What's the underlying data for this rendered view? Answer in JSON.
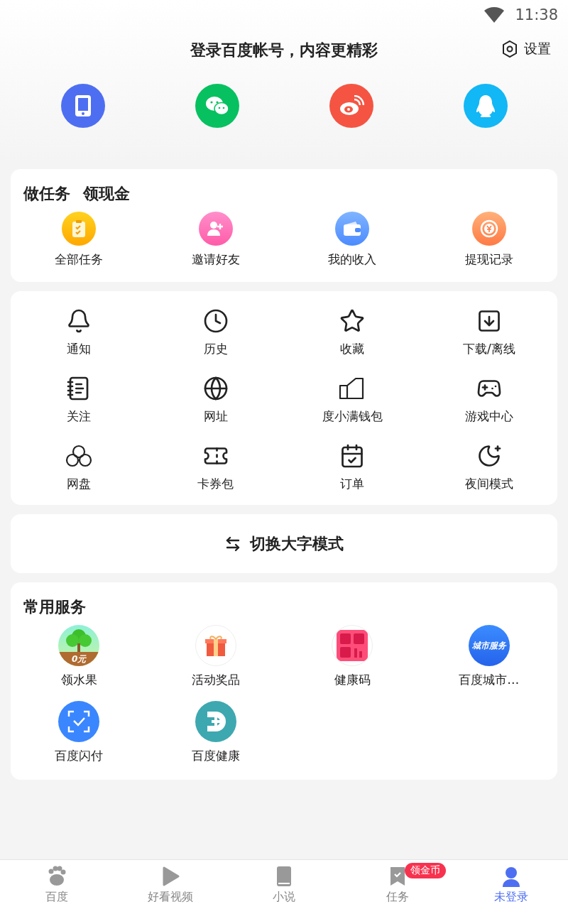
{
  "status_bar": {
    "time": "11:38"
  },
  "header": {
    "title": "登录百度帐号，内容更精彩",
    "settings": "设置"
  },
  "tasks": {
    "title": "做任务",
    "subtitle": "领现金",
    "items": [
      {
        "label": "全部任务"
      },
      {
        "label": "邀请好友"
      },
      {
        "label": "我的收入"
      },
      {
        "label": "提现记录"
      }
    ]
  },
  "tools": [
    {
      "label": "通知"
    },
    {
      "label": "历史"
    },
    {
      "label": "收藏"
    },
    {
      "label": "下载/离线"
    },
    {
      "label": "关注"
    },
    {
      "label": "网址"
    },
    {
      "label": "度小满钱包"
    },
    {
      "label": "游戏中心"
    },
    {
      "label": "网盘"
    },
    {
      "label": "卡券包"
    },
    {
      "label": "订单"
    },
    {
      "label": "夜间模式"
    }
  ],
  "switch_button": {
    "label": "切换大字模式"
  },
  "services": {
    "title": "常用服务",
    "items": [
      {
        "label": "领水果",
        "icon_text": "0元"
      },
      {
        "label": "活动奖品"
      },
      {
        "label": "健康码"
      },
      {
        "label": "百度城市…",
        "icon_text": "城市服务"
      },
      {
        "label": "百度闪付"
      },
      {
        "label": "百度健康"
      }
    ]
  },
  "tab_bar": [
    {
      "label": "百度",
      "selected": false
    },
    {
      "label": "好看视频",
      "selected": false
    },
    {
      "label": "小说",
      "selected": false
    },
    {
      "label": "任务",
      "selected": false,
      "badge": "领金币"
    },
    {
      "label": "未登录",
      "selected": true
    }
  ]
}
